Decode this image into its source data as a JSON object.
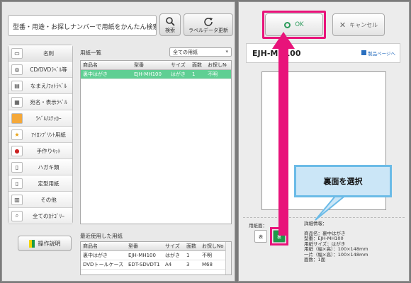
{
  "search": {
    "placeholder": "型番・用途・お探しナンバーで用紙をかんたん検索",
    "search_label": "検索",
    "update_label": "ラベルデータ更新"
  },
  "categories": [
    {
      "label": "名刺",
      "icon": "card-icon"
    },
    {
      "label": "CD/DVDﾗﾍﾞﾙ等",
      "icon": "disc-icon"
    },
    {
      "label": "なまえ/ﾌｫﾄﾗﾍﾞﾙ",
      "icon": "name-label-icon"
    },
    {
      "label": "宛名・表示ﾗﾍﾞﾙ",
      "icon": "address-label-icon"
    },
    {
      "label": "ﾗﾍﾞﾙ/ｽﾃｯｶｰ",
      "icon": "sticker-icon"
    },
    {
      "label": "ｱｲﾛﾝﾌﾟﾘﾝﾄ用紙",
      "icon": "iron-icon"
    },
    {
      "label": "手作りｷｯﾄ",
      "icon": "kit-icon"
    },
    {
      "label": "ハガキ類",
      "icon": "postcard-icon"
    },
    {
      "label": "定型用紙",
      "icon": "paper-icon"
    },
    {
      "label": "その他",
      "icon": "other-icon"
    },
    {
      "label": "全てのｶﾃｺﾞﾘｰ",
      "icon": "magnifier-icon"
    }
  ],
  "help_label": "操作説明",
  "paper_list": {
    "title": "用紙一覧",
    "filter": "全ての用紙",
    "columns": [
      "商品名",
      "型番",
      "サイズ",
      "面数",
      "お探しNo"
    ],
    "rows": [
      [
        "裏中はがき",
        "EJH-MH100",
        "はがき",
        "1",
        "不明"
      ]
    ]
  },
  "recent": {
    "title": "最近使用した用紙",
    "columns": [
      "商品名",
      "型番",
      "サイズ",
      "面数",
      "お探しNo"
    ],
    "rows": [
      [
        "裏中はがき",
        "EJH-MH100",
        "はがき",
        "1",
        "不明"
      ],
      [
        "DVDトールケース",
        "EDT-SDVDT1",
        "A4",
        "3",
        "M68"
      ]
    ]
  },
  "actions": {
    "ok": "OK",
    "cancel": "キャンセル"
  },
  "detail": {
    "model": "EJH-MH100",
    "product_link": "製品ページへ",
    "side_label": "用紙面：",
    "front_label": "表",
    "back_label": "裏",
    "info_title": "詳細情報：",
    "info_lines": [
      "商品名：裏中はがき",
      "型番：EJH-MH100",
      "用紙サイズ：はがき",
      "用紙（幅×高）：100×148mm",
      "一片（幅×高）：100×148mm",
      "面数：1面"
    ],
    "callout": "裏面を選択"
  },
  "colors": {
    "accent": "#e8137a",
    "selected_row": "#5fcf93",
    "callout_border": "#6bbbe7",
    "callout_fill": "#cbe6f7",
    "ok_text": "#2c9b5b"
  }
}
